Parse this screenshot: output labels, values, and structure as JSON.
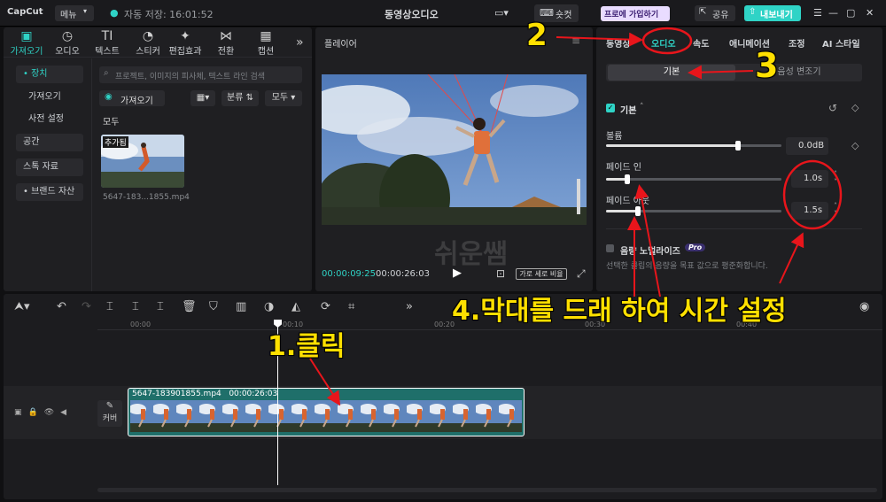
{
  "titlebar": {
    "logo": "CapCut",
    "menu": "메뉴",
    "autosave": "자동 저장: 16:01:52",
    "project_title": "동영상오디오",
    "shortcut": "숏컷",
    "pro_join": "프로에 가입하기",
    "share": "공유",
    "export": "내보내기"
  },
  "left_tabs": [
    "가져오기",
    "오디오",
    "텍스트",
    "스티커",
    "편집효과",
    "전환",
    "캡션"
  ],
  "left_tab_glyphs": [
    "▣",
    "◷",
    "TI",
    "◔",
    "✦",
    "⋈",
    "▦"
  ],
  "sidebar": {
    "items": [
      "• 장치",
      "가져오기",
      "사전 설정",
      "공간",
      "스톡 자료",
      "• 브랜드 자산"
    ]
  },
  "media": {
    "search_placeholder": "프로젝트, 이미지의 피사체, 텍스트 라인 검색",
    "import_button": "가져오기",
    "sort": "분류",
    "filter": "모두",
    "section": "모두",
    "added_badge": "추가됨",
    "clip_name": "5647-183...1855.mp4"
  },
  "player": {
    "title": "플레이어",
    "current_time": "00:00:09:25",
    "total_time": "00:00:26:03",
    "aspect_button": "가로 세로 비율",
    "watermark": "쉬운쌤"
  },
  "right_panel": {
    "tabs": [
      "동영상",
      "오디오",
      "속도",
      "애니메이션",
      "조정",
      "AI 스타일"
    ],
    "active_tab": "오디오",
    "sub_tabs": [
      "기본",
      "음성 변조기"
    ],
    "section": "기본",
    "volume_label": "볼륨",
    "volume_value": "0.0dB",
    "volume_level": 0.75,
    "fade_in_label": "페이드 인",
    "fade_in_value": "1.0s",
    "fade_in_level": 0.12,
    "fade_out_label": "페이드 아웃",
    "fade_out_value": "1.5s",
    "fade_out_level": 0.18,
    "normalize_label": "음량 노멀라이즈",
    "normalize_badge": "Pro",
    "normalize_desc": "선택한 클립의 음량을 목표 값으로 평준화합니다."
  },
  "timeline": {
    "ruler": [
      "00:00",
      "00:10",
      "00:20",
      "00:30",
      "00:40"
    ],
    "cover_label": "커버",
    "clip_label": "5647-183901855.mp4   00:00:26:03"
  },
  "annotations": {
    "n1": "1.클릭",
    "n2": "2",
    "n3": "3",
    "n4": "4.막대를 드래 하여 시간 설정"
  },
  "colors": {
    "accent": "#2fd3c6",
    "annotation_red": "#e8151b",
    "annotation_yellow": "#ffe000"
  }
}
